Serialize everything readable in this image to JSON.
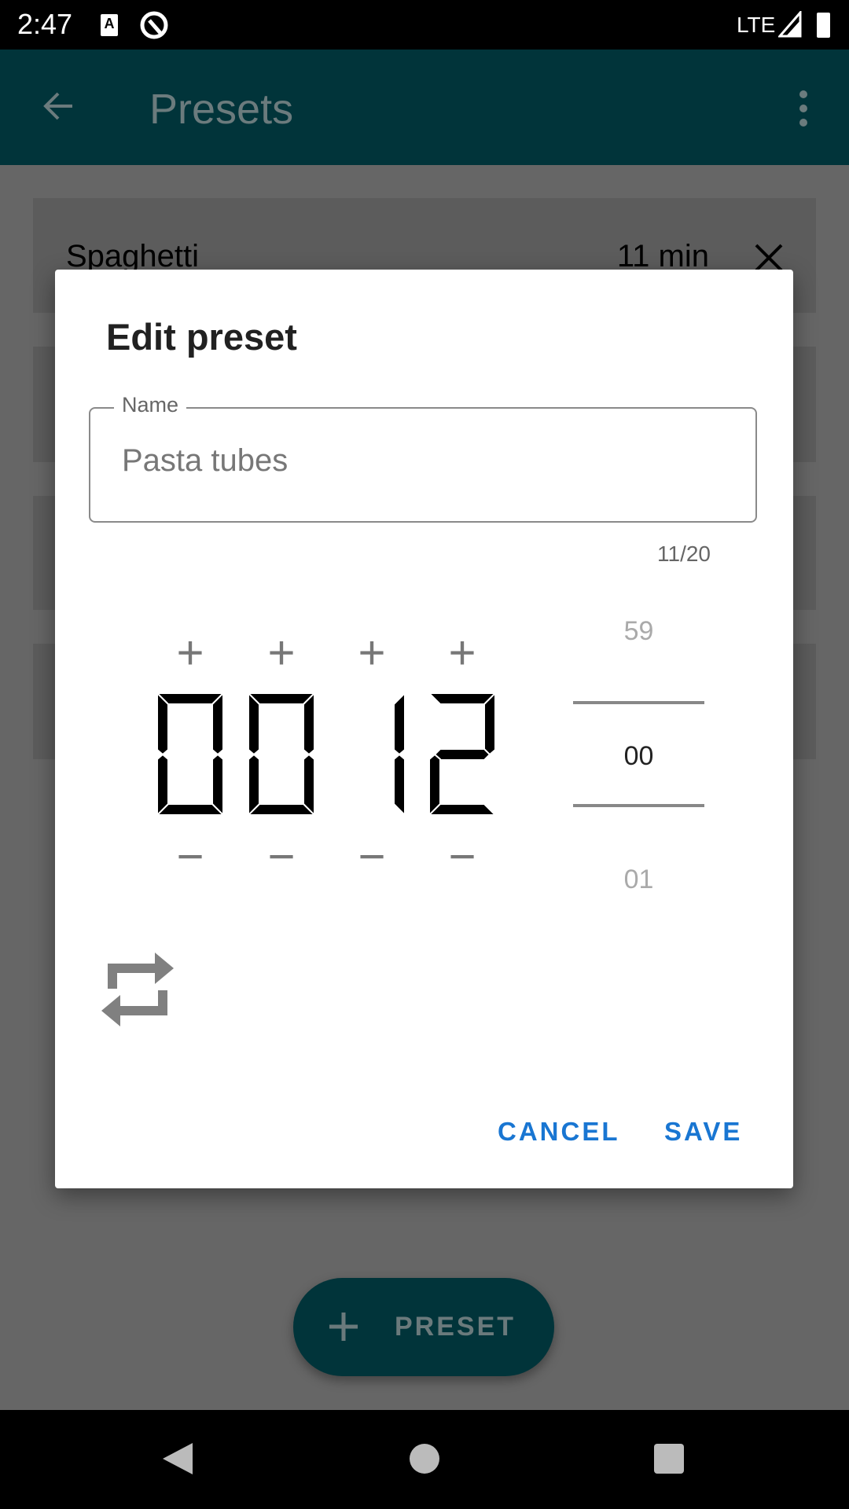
{
  "status_bar": {
    "time": "2:47",
    "network": "LTE",
    "icons": [
      "keyboard-a-icon",
      "data-saver-icon",
      "signal-icon",
      "battery-icon"
    ]
  },
  "toolbar": {
    "title": "Presets",
    "back_icon": "arrow-left-icon",
    "menu_icon": "more-vert-icon"
  },
  "presets": [
    {
      "name": "Spaghetti",
      "duration": "11 min"
    }
  ],
  "dialog": {
    "title": "Edit preset",
    "name_label": "Name",
    "name_value": "Pasta tubes",
    "counter": "11/20",
    "digits": [
      "0",
      "0",
      "1",
      "2"
    ],
    "plus": "+",
    "minus": "−",
    "seconds": {
      "prev": "59",
      "current": "00",
      "next": "01"
    },
    "repeat_icon": "repeat-icon",
    "cancel": "CANCEL",
    "save": "SAVE"
  },
  "fab": {
    "label": "PRESET",
    "icon": "plus"
  },
  "colors": {
    "accent": "#1976d2",
    "toolbar": "#01343a"
  }
}
